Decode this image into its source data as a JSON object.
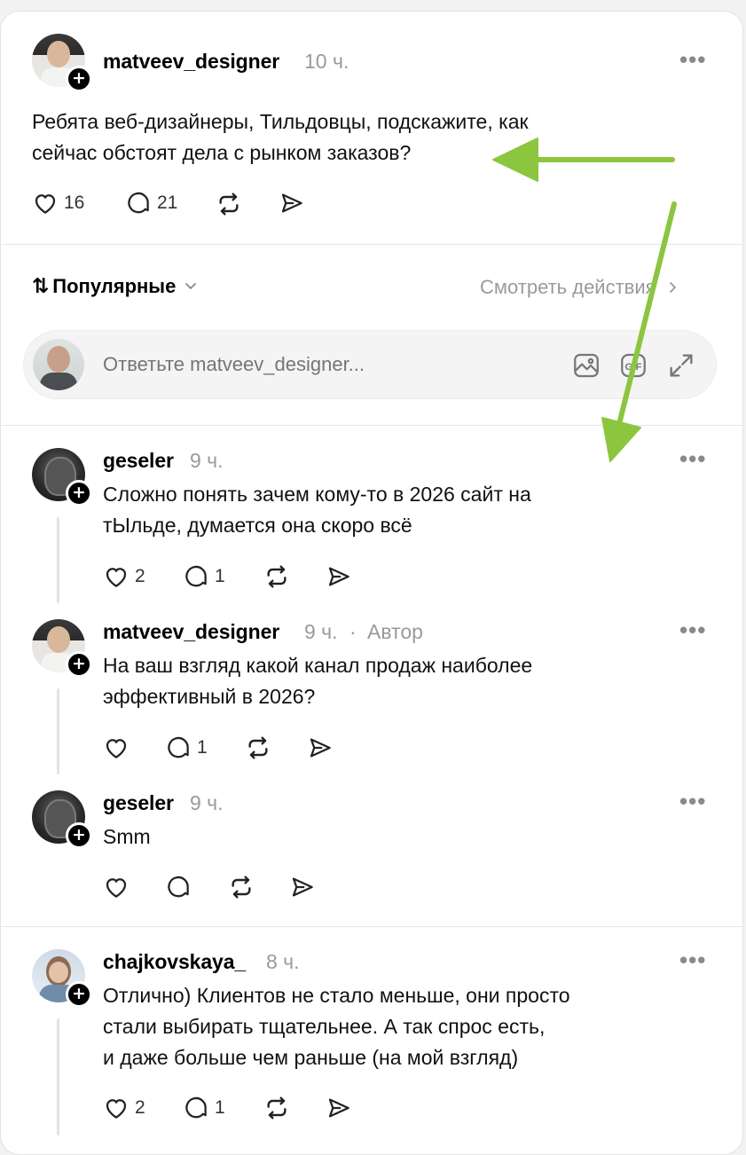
{
  "post": {
    "username": "matveev_designer",
    "time": "10 ч.",
    "text_line1": "Ребята веб-дизайнеры, Тильдовцы, подскажите, как",
    "text_line2": "сейчас обстоят дела с рынком заказов?",
    "likes": "16",
    "comments": "21"
  },
  "sort": {
    "label": "Популярные",
    "view_actions": "Смотреть действия"
  },
  "reply": {
    "placeholder": "Ответьте matveev_designer..."
  },
  "comments": [
    {
      "username": "geseler",
      "time": "9 ч.",
      "line1": "Сложно понять зачем кому-то в 2026 сайт на",
      "line2": "тЫльде, думается она скоро всё",
      "likes": "2",
      "replies": "1"
    },
    {
      "username": "matveev_designer",
      "time": "9 ч.",
      "author_badge": "Автор",
      "line1": "На ваш взгляд какой канал продаж наиболее",
      "line2": "эффективный в 2026?",
      "likes": "",
      "replies": "1"
    },
    {
      "username": "geseler",
      "time": "9 ч.",
      "line1": "Smm",
      "likes": "",
      "replies": ""
    },
    {
      "username": "chajkovskaya_",
      "time": "8 ч.",
      "line1": "Отлично) Клиентов не стало меньше, они просто",
      "line2": "стали выбирать тщательнее. А так спрос есть,",
      "line3": "и даже больше чем раньше (на мой взгляд)",
      "likes": "2",
      "replies": "1"
    }
  ],
  "colors": {
    "annotation_arrow": "#8cc63f",
    "muted_text": "#9a9a9a"
  }
}
